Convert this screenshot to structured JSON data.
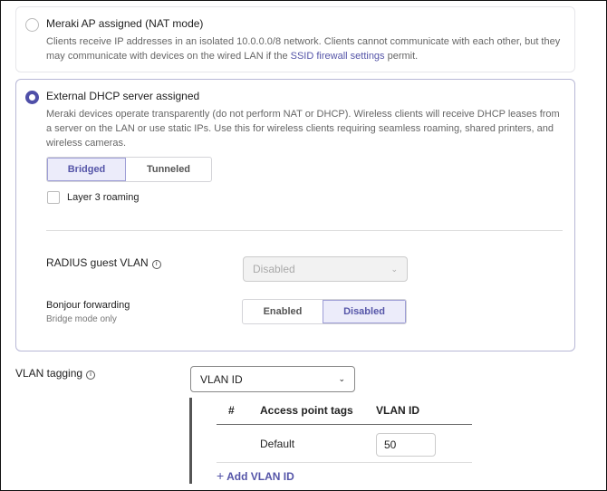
{
  "nat_option": {
    "title": "Meraki AP assigned (NAT mode)",
    "desc_prefix": "Clients receive IP addresses in an isolated 10.0.0.0/8 network. Clients cannot communicate with each other, but they may communicate with devices on the wired LAN if the ",
    "link": "SSID firewall settings",
    "desc_suffix": " permit.",
    "selected": false
  },
  "dhcp_option": {
    "title": "External DHCP server assigned",
    "desc": "Meraki devices operate transparently (do not perform NAT or DHCP). Wireless clients will receive DHCP leases from a server on the LAN or use static IPs. Use this for wireless clients requiring seamless roaming, shared printers, and wireless cameras.",
    "selected": true,
    "mode": {
      "options": [
        "Bridged",
        "Tunneled"
      ],
      "selected": "Bridged"
    },
    "layer3_roaming": {
      "label": "Layer 3 roaming",
      "checked": false
    },
    "radius_guest_vlan": {
      "label": "RADIUS guest VLAN",
      "value": "Disabled"
    },
    "bonjour": {
      "label": "Bonjour forwarding",
      "sub": "Bridge mode only",
      "options": [
        "Enabled",
        "Disabled"
      ],
      "selected": "Disabled"
    }
  },
  "vlan_tagging": {
    "label": "VLAN tagging",
    "value": "VLAN ID",
    "table": {
      "headers": [
        "#",
        "Access point tags",
        "VLAN ID"
      ],
      "rows": [
        {
          "num": "",
          "tags": "Default",
          "vlan": "50"
        }
      ]
    },
    "add_label": "Add VLAN ID"
  },
  "colors": {
    "accent": "#5555a8"
  }
}
